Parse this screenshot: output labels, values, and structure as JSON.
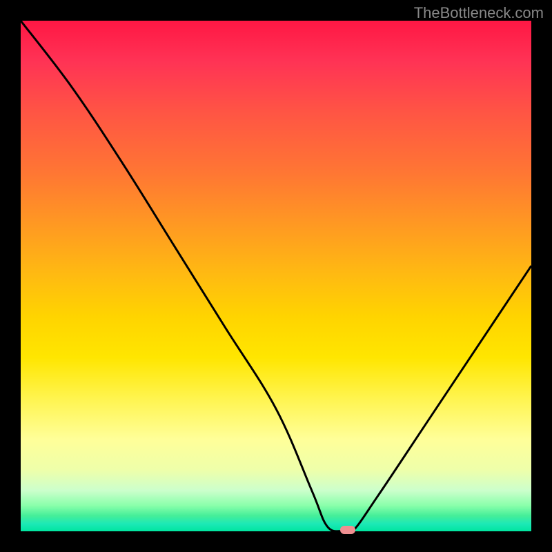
{
  "attribution": "TheBottleneck.com",
  "chart_data": {
    "type": "line",
    "title": "",
    "xlabel": "",
    "ylabel": "",
    "xlim": [
      0,
      100
    ],
    "ylim": [
      0,
      100
    ],
    "series": [
      {
        "name": "bottleneck-curve",
        "x": [
          0,
          10,
          20,
          30,
          40,
          50,
          57,
          60,
          63,
          65,
          70,
          80,
          90,
          100
        ],
        "values": [
          100,
          87,
          72,
          56,
          40,
          24,
          8,
          1,
          0,
          0,
          7,
          22,
          37,
          52
        ]
      }
    ],
    "marker": {
      "x": 64,
      "y": 0
    },
    "background": {
      "type": "vertical-gradient",
      "stops": [
        {
          "pos": 0,
          "color": "#ff1744"
        },
        {
          "pos": 50,
          "color": "#ffd400"
        },
        {
          "pos": 82,
          "color": "#ffff99"
        },
        {
          "pos": 100,
          "color": "#00e5a0"
        }
      ]
    }
  },
  "colors": {
    "curve": "#000000",
    "marker": "#ef8f91",
    "frame": "#000000"
  }
}
